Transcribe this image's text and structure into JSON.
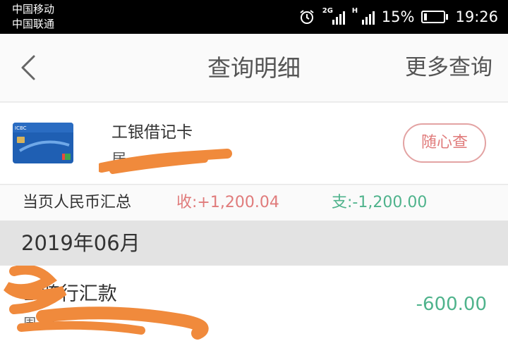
{
  "status_bar": {
    "carrier_primary": "中国移动",
    "carrier_secondary": "中国联通",
    "network_1": "2G",
    "network_2": "H",
    "battery_percent": "15%",
    "battery_level": 0.15,
    "time": "19:26"
  },
  "nav": {
    "title": "查询明细",
    "more_label": "更多查询"
  },
  "card": {
    "name": "工银借记卡",
    "number_visible": "居",
    "query_button": "随心查"
  },
  "summary": {
    "label": "当页人民币汇总",
    "income": "收:+1,200.04",
    "expense": "支:-1,200.00"
  },
  "month": "2019年06月",
  "transactions": [
    {
      "title": "1     跨行汇款",
      "subtitle": "周              菲",
      "amount": "-600.00"
    }
  ],
  "colors": {
    "income": "#e07b7b",
    "expense": "#4fb38c",
    "redaction": "#f08a3c"
  }
}
